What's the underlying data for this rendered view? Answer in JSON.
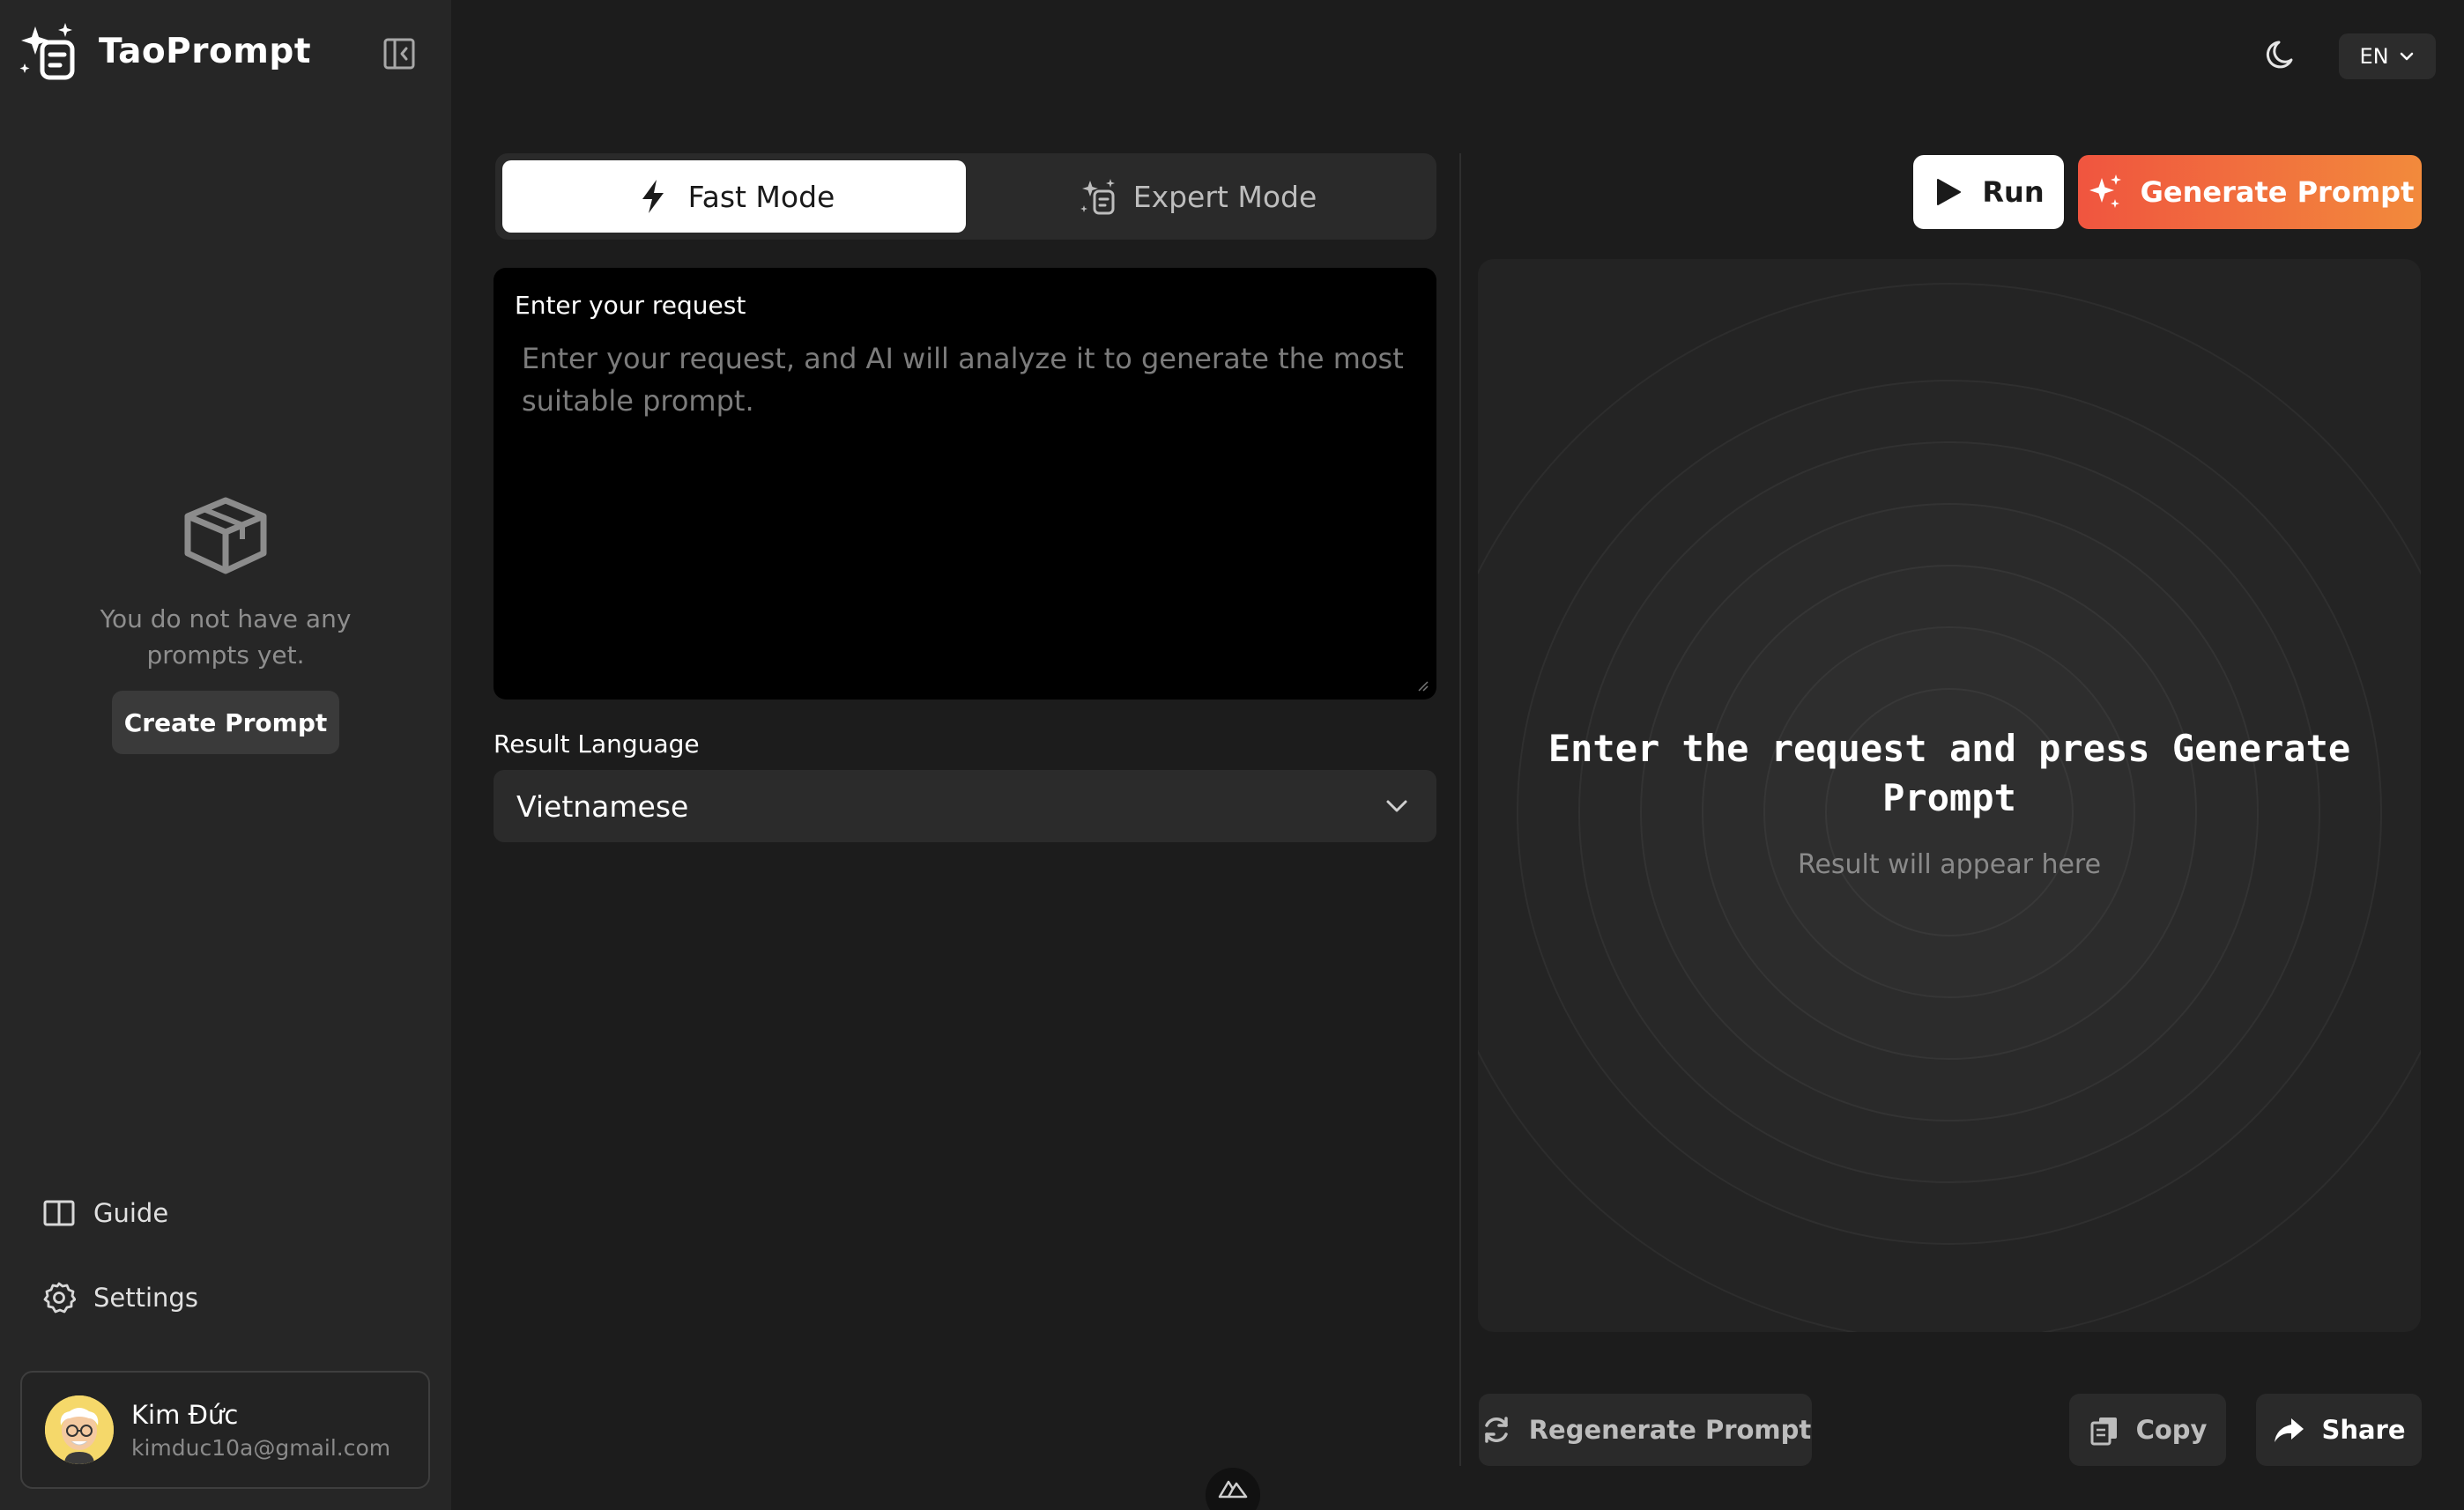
{
  "app": {
    "brand_name": "TaoPrompt",
    "icons": {
      "logo": "sparkle-logo-icon",
      "collapse": "sidebar-collapse-icon"
    }
  },
  "sidebar": {
    "empty_state": {
      "icon": "open-box-icon",
      "message": "You do not have any prompts yet.",
      "create_label": "Create Prompt"
    },
    "nav": [
      {
        "label": "Guide",
        "icon": "book-icon"
      },
      {
        "label": "Settings",
        "icon": "gear-icon"
      }
    ],
    "user": {
      "name": "Kim Đức",
      "email": "kimduc10a@gmail.com"
    }
  },
  "header": {
    "theme_icon": "moon-icon",
    "language": "EN"
  },
  "modes": {
    "fast_label": "Fast Mode",
    "expert_label": "Expert Mode",
    "selected": "Fast Mode"
  },
  "request": {
    "label": "Enter your request",
    "value": "",
    "placeholder": "Enter your request, and AI will analyze it to generate the most suitable prompt."
  },
  "result_language": {
    "label": "Result Language",
    "value": "Vietnamese"
  },
  "actions": {
    "run_label": "Run",
    "generate_label": "Generate Prompt",
    "regenerate_label": "Regenerate Prompt",
    "copy_label": "Copy",
    "share_label": "Share"
  },
  "result": {
    "title": "Enter the request and press Generate Prompt",
    "subtitle": "Result will appear here"
  },
  "colors": {
    "accent_start": "#f0553f",
    "accent_end": "#f28a3c",
    "background": "#1c1c1c",
    "sidebar": "#262626"
  }
}
